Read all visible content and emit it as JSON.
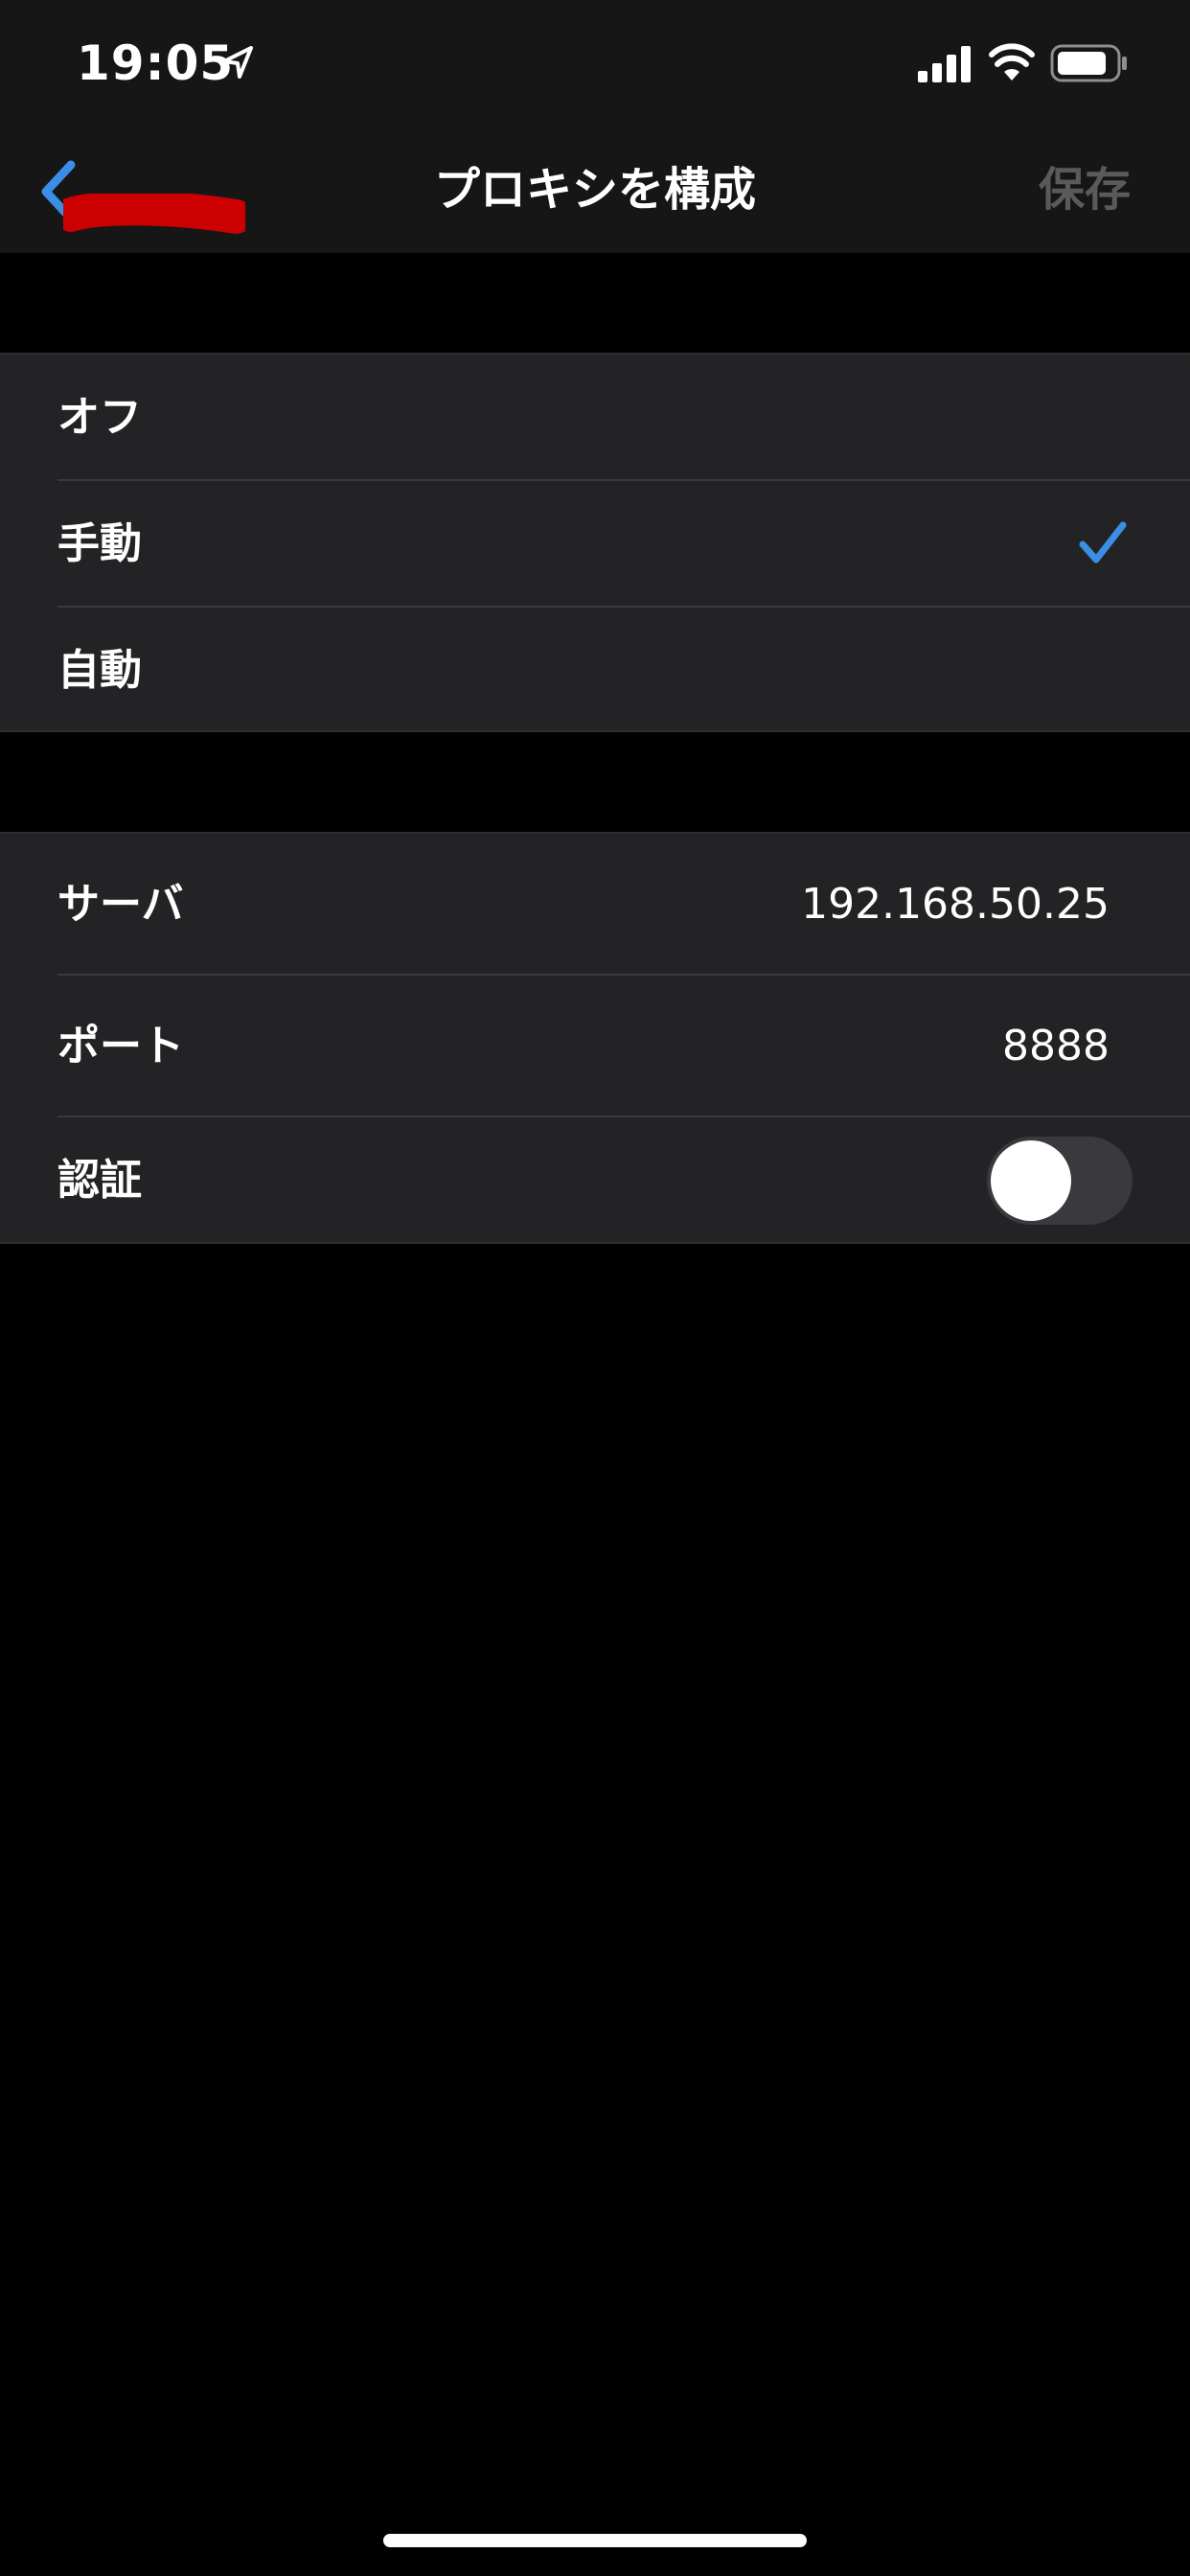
{
  "status_bar": {
    "time": "19:05",
    "icons": [
      "location-arrow-icon",
      "cellular-signal-icon",
      "wifi-icon",
      "battery-icon"
    ]
  },
  "nav": {
    "back_icon": "chevron-left-icon",
    "title": "プロキシを構成",
    "save_label": "保存"
  },
  "mode_options": [
    {
      "label": "オフ",
      "selected": false
    },
    {
      "label": "手動",
      "selected": true
    },
    {
      "label": "自動",
      "selected": false
    }
  ],
  "proxy_settings": {
    "server": {
      "label": "サーバ",
      "value": "192.168.50.25"
    },
    "port": {
      "label": "ポート",
      "value": "8888"
    },
    "auth": {
      "label": "認証",
      "enabled": false
    }
  },
  "colors": {
    "accent": "#3a8ee6",
    "background": "#000000",
    "group_background": "#232325",
    "nav_background": "#161616",
    "disabled_text": "#5a5a5c",
    "redaction": "#cc0000"
  }
}
